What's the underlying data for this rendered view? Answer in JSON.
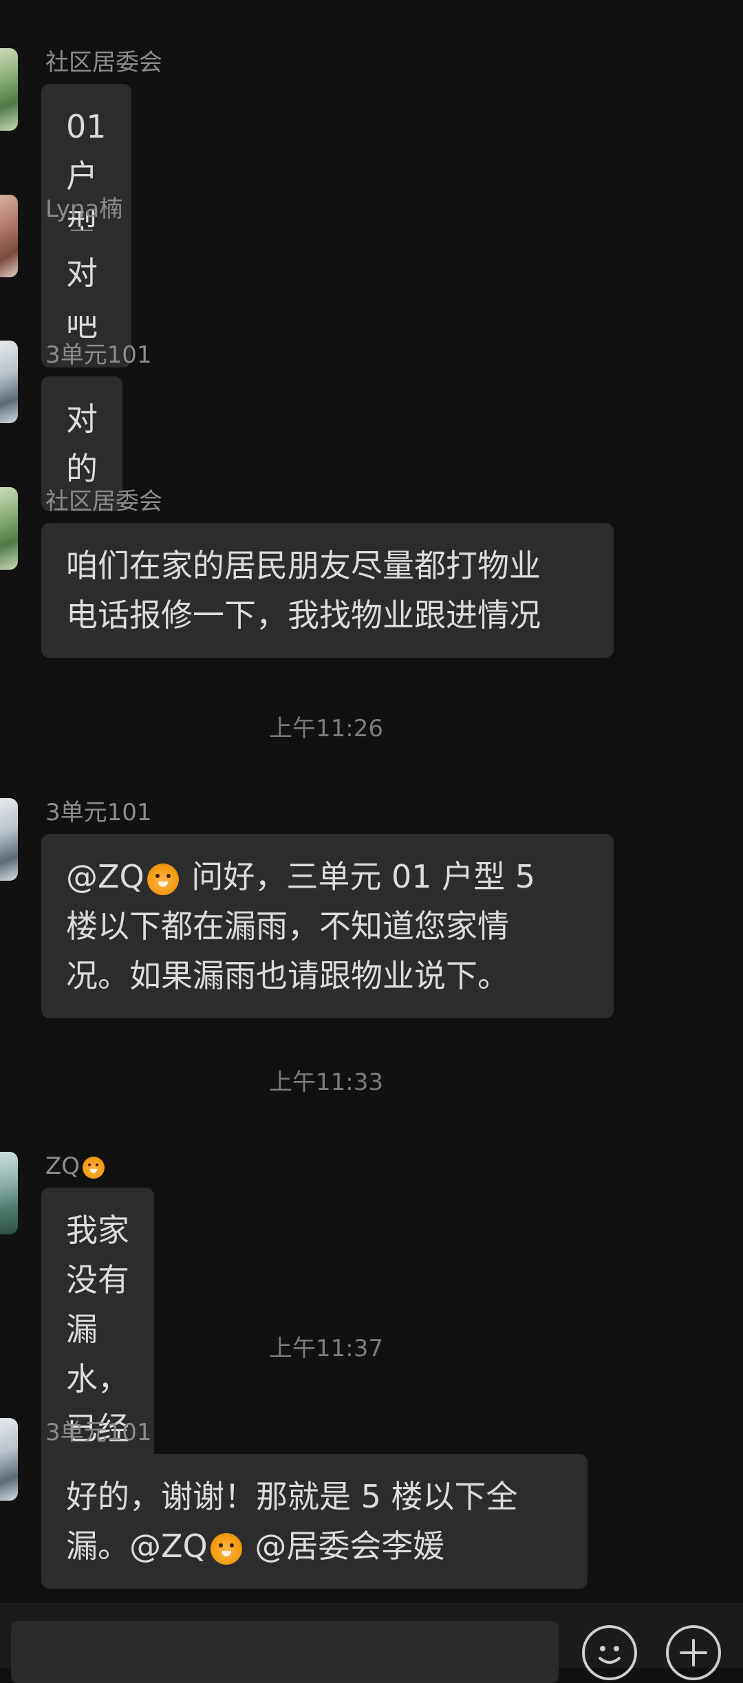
{
  "messages": [
    {
      "sender": "社区居委会",
      "text": "01 户型对吧"
    },
    {
      "sender": "Lyna楠",
      "text": "对"
    },
    {
      "sender": "3单元101",
      "text": "对的"
    },
    {
      "sender": "社区居委会",
      "lines": [
        "咱们在家的居民朋友尽量都打物业",
        "电话报修一下，我找物业跟进情况"
      ]
    },
    {
      "time": "上午11:26"
    },
    {
      "sender": "3单元101",
      "mention": "@ZQ",
      "lines": [
        "问好，三单元 01 户型 5",
        "楼以下都在漏雨，不知道您家情",
        "况。如果漏雨也请跟物业说下。"
      ]
    },
    {
      "time": "上午11:33"
    },
    {
      "sender": "ZQ",
      "text": "我家没有漏水，已经看过了"
    },
    {
      "time": "上午11:37"
    },
    {
      "sender": "3单元101",
      "line1": "好的，谢谢！那就是 5 楼以下全",
      "line2_a": "漏。@ZQ",
      "line2_b": "@居委会李媛"
    }
  ],
  "icons": {
    "tiger_emoji": "tiger-face-emoji",
    "emoji_button": "emoji-face-icon",
    "plus_button": "plus-icon"
  },
  "colors": {
    "background": "#111111",
    "bubble": "#2c2c2c",
    "text": "#dcdcdc",
    "meta": "#8c8c8c"
  }
}
